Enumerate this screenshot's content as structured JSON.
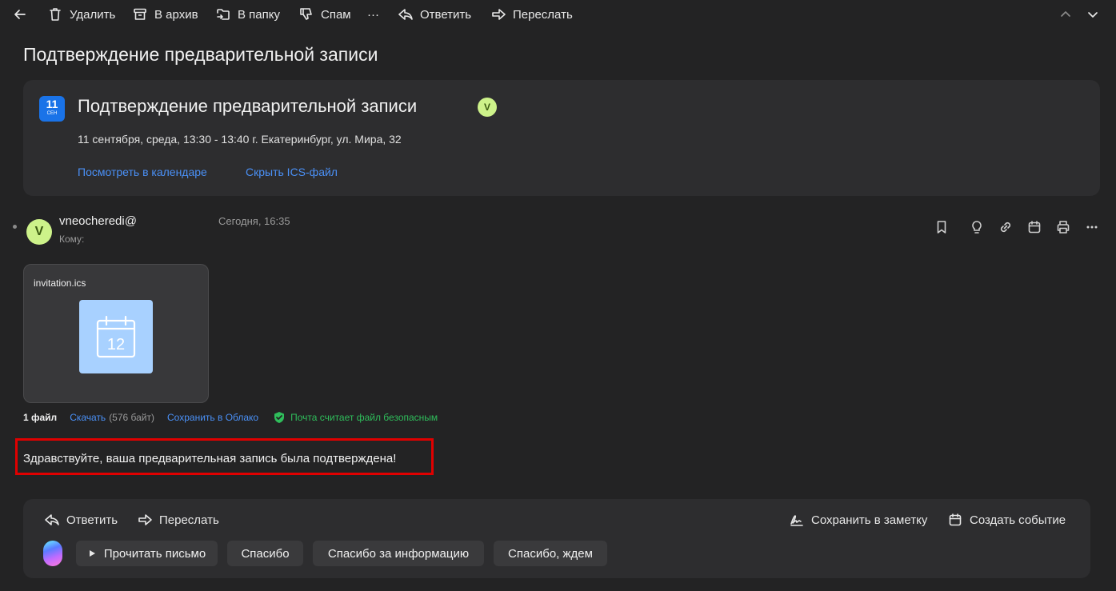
{
  "toolbar": {
    "delete_label": "Удалить",
    "archive_label": "В архив",
    "folder_label": "В папку",
    "spam_label": "Спам",
    "more_label": "···",
    "reply_label": "Ответить",
    "forward_label": "Переслать"
  },
  "page": {
    "title": "Подтверждение предварительной записи"
  },
  "event": {
    "badge_day": "11",
    "badge_month": "СЕН",
    "title": "Подтверждение предварительной записи",
    "avatar_letter": "V",
    "when": "11 сентября, среда, 13:30 - 13:40 г. Екатеринбург, ул. Мира, 32",
    "view_calendar_link": "Посмотреть в календаре",
    "hide_ics_link": "Скрыть ICS-файл"
  },
  "message": {
    "avatar_letter": "V",
    "sender": "vneocheredi@",
    "recipient_label": "Кому:",
    "date": "Сегодня, 16:35",
    "body": "Здравствуйте, ваша предварительная запись была подтверждена!"
  },
  "attachment": {
    "filename": "invitation.ics",
    "icon_day": "12",
    "files_count": "1 файл",
    "download_link": "Скачать",
    "size": "(576 байт)",
    "save_cloud_link": "Сохранить в Облако",
    "safe_text": "Почта считает файл безопасным"
  },
  "reply_panel": {
    "reply_label": "Ответить",
    "forward_label": "Переслать",
    "save_note_label": "Сохранить в заметку",
    "create_event_label": "Создать событие",
    "chips": [
      "Прочитать письмо",
      "Спасибо",
      "Спасибо за информацию",
      "Спасибо, ждем"
    ]
  },
  "colors": {
    "background": "#232324",
    "card": "#2d2d2f",
    "link": "#4a90f6",
    "safe": "#2fbd5b",
    "highlight": "#e00000",
    "calendar_blue": "#1a73e8",
    "avatar": "#cdf28a"
  }
}
